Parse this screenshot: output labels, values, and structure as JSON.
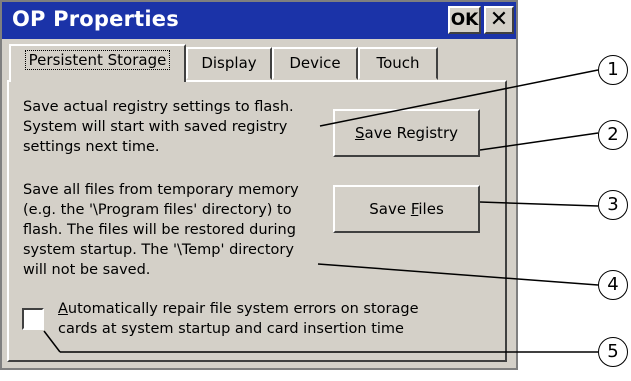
{
  "window": {
    "title": "OP Properties",
    "ok_label": "OK",
    "close_glyph": "✕"
  },
  "tabs": [
    {
      "label": "Persistent Storage",
      "active": true
    },
    {
      "label": "Display",
      "active": false
    },
    {
      "label": "Device",
      "active": false
    },
    {
      "label": "Touch",
      "active": false
    }
  ],
  "registry": {
    "description": [
      "Save actual registry settings to flash.",
      "System will start with saved registry",
      "settings next time."
    ],
    "button_mnemonic": "S",
    "button_rest": "ave Registry"
  },
  "files": {
    "description": [
      "Save all files from temporary memory",
      "(e.g. the '\\Program files' directory) to",
      "flash. The files will be restored during",
      "system startup. The '\\Temp' directory",
      "will not be saved."
    ],
    "button_prefix": "Save ",
    "button_mnemonic": "F",
    "button_rest": "iles"
  },
  "repair": {
    "checked": false,
    "label_mnemonic": "A",
    "label_rest_line1": "utomatically repair file system errors on storage",
    "label_line2": "cards at system startup and card insertion time"
  },
  "callouts": [
    "1",
    "2",
    "3",
    "4",
    "5"
  ]
}
